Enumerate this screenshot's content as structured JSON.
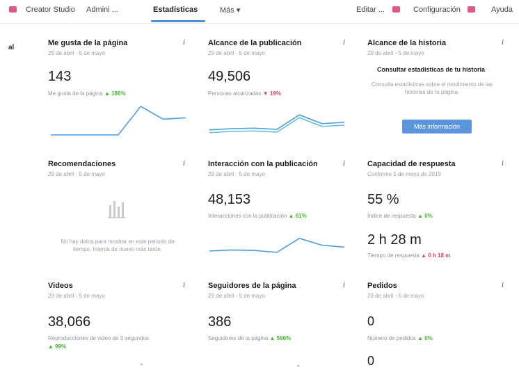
{
  "nav": {
    "creator_studio": "Creator Studio",
    "admin": "Admini ...",
    "stats": "Estadísticas",
    "more": "Más ▾",
    "edit": "Editar ...",
    "settings": "Configuración",
    "help": "Ayuda",
    "accent": "#e0578a"
  },
  "side_label": "al",
  "cards": {
    "likes": {
      "title": "Me gusta de la página",
      "date": "29 de abril - 5 de mayo",
      "value": "143",
      "sub": "Me gusta de la página",
      "change": "▲ 186%",
      "series": [
        0,
        0,
        0,
        0,
        1,
        0.55,
        0.6
      ]
    },
    "reach": {
      "title": "Alcance de la publicación",
      "date": "29 de abril - 5 de mayo",
      "value": "49,506",
      "sub": "Personas alcanzadas",
      "change": "▼ 19%",
      "series": [
        0.2,
        0.25,
        0.27,
        0.22,
        0.8,
        0.45,
        0.5
      ]
    },
    "story": {
      "title": "Alcance de la historia",
      "date": "29 de abril - 5 de mayo",
      "heading": "Consultar estadísticas de tu historia",
      "body": "Consulta estadísticas sobre el rendimiento de las historias de tu página.",
      "button": "Más información"
    },
    "recommendations": {
      "title": "Recomendaciones",
      "date": "29 de abril - 5 de mayo",
      "empty": "No hay datos para mostrar en este periodo de tiempo. Intenta de nuevo más tarde."
    },
    "engagement": {
      "title": "Interacción con la publicación",
      "date": "29 de abril - 5 de mayo",
      "value": "48,153",
      "sub": "Interacciones con la publicación",
      "change": "▲ 61%",
      "series": [
        0.25,
        0.3,
        0.28,
        0.18,
        0.9,
        0.55,
        0.45
      ]
    },
    "response": {
      "title": "Capacidad de respuesta",
      "date": "Conforme 5 de mayo de 2019",
      "value": "55 %",
      "sub": "Índice de respuesta",
      "change": "▲ 0%",
      "value2": "2 h 28 m",
      "sub2": "Tiempo de respuesta",
      "change2": "▲ 0 h 18 m"
    },
    "videos": {
      "title": "Videos",
      "date": "29 de abril - 5 de mayo",
      "value": "38,066",
      "sub": "Reproducciones de video de 3 segundos",
      "change": "▲ 99%"
    },
    "followers": {
      "title": "Seguidores de la página",
      "date": "29 de abril - 5 de mayo",
      "value": "386",
      "sub": "Seguidores de la página",
      "change": "▲ 566%"
    },
    "orders": {
      "title": "Pedidos",
      "date": "29 de abril - 5 de mayo",
      "value": "0",
      "sub": "Número de pedidos",
      "change": "▲ 0%",
      "value2": "0"
    }
  }
}
